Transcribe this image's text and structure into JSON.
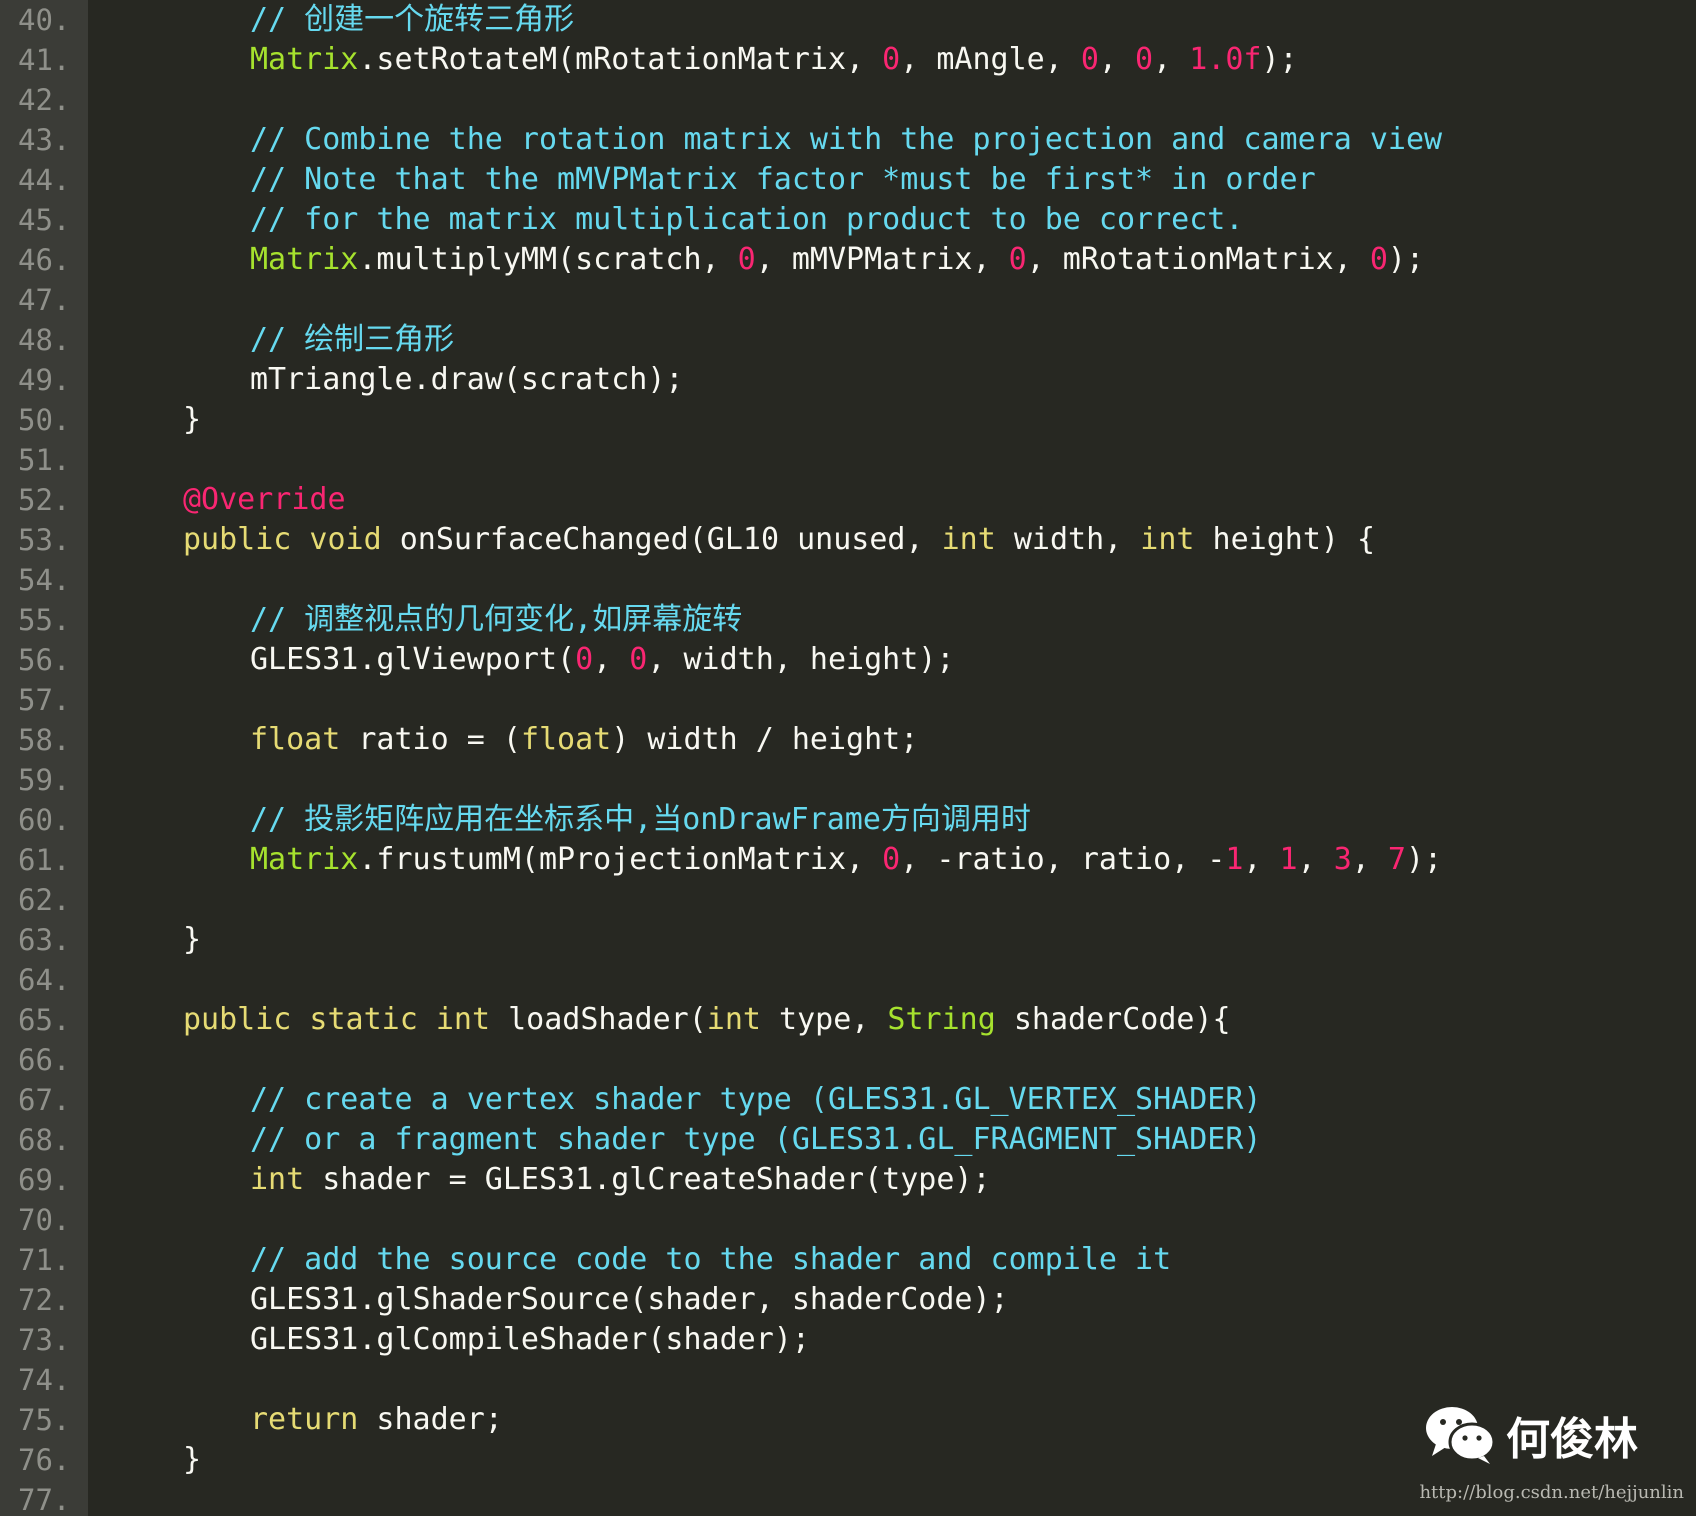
{
  "theme": {
    "background": "#272822",
    "gutter": "#3b3c37",
    "line_number": "#8f908a",
    "plain": "#f8f8f2",
    "keyword": "#e6db74",
    "type": "#a6e22e",
    "number": "#f92672",
    "comment": "#66d9ef",
    "annotation": "#f92672"
  },
  "lines": [
    {
      "num": "40.",
      "indent": 2,
      "tokens": [
        {
          "c": "cm",
          "t": "// 创建一个旋转三角形"
        }
      ]
    },
    {
      "num": "41.",
      "indent": 2,
      "tokens": [
        {
          "c": "ty",
          "t": "Matrix"
        },
        {
          "c": "pl",
          "t": ".setRotateM(mRotationMatrix, "
        },
        {
          "c": "num",
          "t": "0"
        },
        {
          "c": "pl",
          "t": ", mAngle, "
        },
        {
          "c": "num",
          "t": "0"
        },
        {
          "c": "pl",
          "t": ", "
        },
        {
          "c": "num",
          "t": "0"
        },
        {
          "c": "pl",
          "t": ", "
        },
        {
          "c": "num",
          "t": "1.0f"
        },
        {
          "c": "pl",
          "t": ");"
        }
      ]
    },
    {
      "num": "42.",
      "indent": 0,
      "tokens": []
    },
    {
      "num": "43.",
      "indent": 2,
      "tokens": [
        {
          "c": "cm",
          "t": "// Combine the rotation matrix with the projection and camera view"
        }
      ]
    },
    {
      "num": "44.",
      "indent": 2,
      "tokens": [
        {
          "c": "cm",
          "t": "// Note that the mMVPMatrix factor *must be first* in order"
        }
      ]
    },
    {
      "num": "45.",
      "indent": 2,
      "tokens": [
        {
          "c": "cm",
          "t": "// for the matrix multiplication product to be correct."
        }
      ]
    },
    {
      "num": "46.",
      "indent": 2,
      "tokens": [
        {
          "c": "ty",
          "t": "Matrix"
        },
        {
          "c": "pl",
          "t": ".multiplyMM(scratch, "
        },
        {
          "c": "num",
          "t": "0"
        },
        {
          "c": "pl",
          "t": ", mMVPMatrix, "
        },
        {
          "c": "num",
          "t": "0"
        },
        {
          "c": "pl",
          "t": ", mRotationMatrix, "
        },
        {
          "c": "num",
          "t": "0"
        },
        {
          "c": "pl",
          "t": ");"
        }
      ]
    },
    {
      "num": "47.",
      "indent": 0,
      "tokens": []
    },
    {
      "num": "48.",
      "indent": 2,
      "tokens": [
        {
          "c": "cm",
          "t": "// 绘制三角形"
        }
      ]
    },
    {
      "num": "49.",
      "indent": 2,
      "tokens": [
        {
          "c": "pl",
          "t": "mTriangle.draw(scratch);"
        }
      ]
    },
    {
      "num": "50.",
      "indent": 1,
      "tokens": [
        {
          "c": "pl",
          "t": "}"
        }
      ]
    },
    {
      "num": "51.",
      "indent": 0,
      "tokens": []
    },
    {
      "num": "52.",
      "indent": 1,
      "tokens": [
        {
          "c": "an",
          "t": "@Override"
        }
      ]
    },
    {
      "num": "53.",
      "indent": 1,
      "tokens": [
        {
          "c": "kw",
          "t": "public void"
        },
        {
          "c": "pl",
          "t": " onSurfaceChanged(GL10 unused, "
        },
        {
          "c": "kw",
          "t": "int"
        },
        {
          "c": "pl",
          "t": " width, "
        },
        {
          "c": "kw",
          "t": "int"
        },
        {
          "c": "pl",
          "t": " height) {"
        }
      ]
    },
    {
      "num": "54.",
      "indent": 0,
      "tokens": []
    },
    {
      "num": "55.",
      "indent": 2,
      "tokens": [
        {
          "c": "cm",
          "t": "// 调整视点的几何变化,如屏幕旋转"
        }
      ]
    },
    {
      "num": "56.",
      "indent": 2,
      "tokens": [
        {
          "c": "pl",
          "t": "GLES31.glViewport("
        },
        {
          "c": "num",
          "t": "0"
        },
        {
          "c": "pl",
          "t": ", "
        },
        {
          "c": "num",
          "t": "0"
        },
        {
          "c": "pl",
          "t": ", width, height);"
        }
      ]
    },
    {
      "num": "57.",
      "indent": 0,
      "tokens": []
    },
    {
      "num": "58.",
      "indent": 2,
      "tokens": [
        {
          "c": "kw",
          "t": "float"
        },
        {
          "c": "pl",
          "t": " ratio = ("
        },
        {
          "c": "kw",
          "t": "float"
        },
        {
          "c": "pl",
          "t": ") width / height;"
        }
      ]
    },
    {
      "num": "59.",
      "indent": 0,
      "tokens": []
    },
    {
      "num": "60.",
      "indent": 2,
      "tokens": [
        {
          "c": "cm",
          "t": "// 投影矩阵应用在坐标系中,当onDrawFrame方向调用时"
        }
      ]
    },
    {
      "num": "61.",
      "indent": 2,
      "tokens": [
        {
          "c": "ty",
          "t": "Matrix"
        },
        {
          "c": "pl",
          "t": ".frustumM(mProjectionMatrix, "
        },
        {
          "c": "num",
          "t": "0"
        },
        {
          "c": "pl",
          "t": ", -ratio, ratio, -"
        },
        {
          "c": "num",
          "t": "1"
        },
        {
          "c": "pl",
          "t": ", "
        },
        {
          "c": "num",
          "t": "1"
        },
        {
          "c": "pl",
          "t": ", "
        },
        {
          "c": "num",
          "t": "3"
        },
        {
          "c": "pl",
          "t": ", "
        },
        {
          "c": "num",
          "t": "7"
        },
        {
          "c": "pl",
          "t": ");"
        }
      ]
    },
    {
      "num": "62.",
      "indent": 0,
      "tokens": []
    },
    {
      "num": "63.",
      "indent": 1,
      "tokens": [
        {
          "c": "pl",
          "t": "}"
        }
      ]
    },
    {
      "num": "64.",
      "indent": 0,
      "tokens": []
    },
    {
      "num": "65.",
      "indent": 1,
      "tokens": [
        {
          "c": "kw",
          "t": "public static int"
        },
        {
          "c": "pl",
          "t": " loadShader("
        },
        {
          "c": "kw",
          "t": "int"
        },
        {
          "c": "pl",
          "t": " type, "
        },
        {
          "c": "ty",
          "t": "String"
        },
        {
          "c": "pl",
          "t": " shaderCode){"
        }
      ]
    },
    {
      "num": "66.",
      "indent": 0,
      "tokens": []
    },
    {
      "num": "67.",
      "indent": 2,
      "tokens": [
        {
          "c": "cm",
          "t": "// create a vertex shader type (GLES31.GL_VERTEX_SHADER)"
        }
      ]
    },
    {
      "num": "68.",
      "indent": 2,
      "tokens": [
        {
          "c": "cm",
          "t": "// or a fragment shader type (GLES31.GL_FRAGMENT_SHADER)"
        }
      ]
    },
    {
      "num": "69.",
      "indent": 2,
      "tokens": [
        {
          "c": "kw",
          "t": "int"
        },
        {
          "c": "pl",
          "t": " shader = GLES31.glCreateShader(type);"
        }
      ]
    },
    {
      "num": "70.",
      "indent": 0,
      "tokens": []
    },
    {
      "num": "71.",
      "indent": 2,
      "tokens": [
        {
          "c": "cm",
          "t": "// add the source code to the shader and compile it"
        }
      ]
    },
    {
      "num": "72.",
      "indent": 2,
      "tokens": [
        {
          "c": "pl",
          "t": "GLES31.glShaderSource(shader, shaderCode);"
        }
      ]
    },
    {
      "num": "73.",
      "indent": 2,
      "tokens": [
        {
          "c": "pl",
          "t": "GLES31.glCompileShader(shader);"
        }
      ]
    },
    {
      "num": "74.",
      "indent": 0,
      "tokens": []
    },
    {
      "num": "75.",
      "indent": 2,
      "tokens": [
        {
          "c": "kw",
          "t": "return"
        },
        {
          "c": "pl",
          "t": " shader;"
        }
      ]
    },
    {
      "num": "76.",
      "indent": 1,
      "tokens": [
        {
          "c": "pl",
          "t": "}"
        }
      ]
    },
    {
      "num": "77.",
      "indent": 0,
      "tokens": []
    }
  ],
  "watermark": {
    "icon": "wechat-icon",
    "name": "何俊林",
    "url": "http://blog.csdn.net/hejjunlin"
  }
}
